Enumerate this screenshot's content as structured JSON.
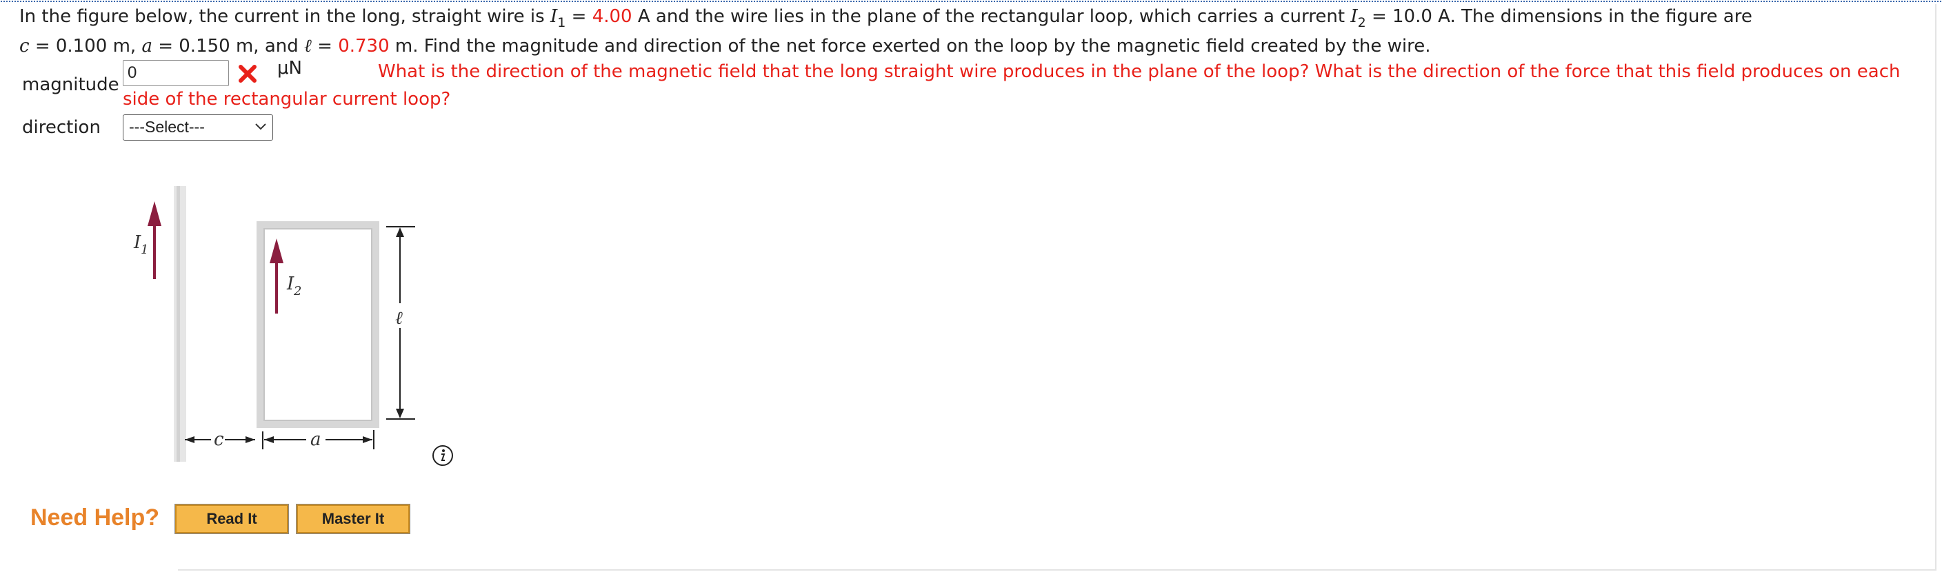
{
  "question": {
    "intro": "In the figure below, the current in the long, straight wire is ",
    "i1_symbol": "I",
    "i1_sub": "1",
    "eq1": " = ",
    "i1_value": "4.00",
    "text2": " A and the wire lies in the plane of the rectangular loop, which carries a current ",
    "i2_symbol": "I",
    "i2_sub": "2",
    "text3": " = 10.0 A. The dimensions in the figure are",
    "c_symbol": "c",
    "text4": " = 0.100 m, ",
    "a_symbol": "a",
    "text5": " = 0.150 m, and ",
    "l_symbol": "ℓ",
    "eq2": " = ",
    "l_value": "0.730",
    "text6": " m. Find the magnitude and direction of the net force exerted on the loop by the magnetic field created by the wire."
  },
  "answer": {
    "magnitude_label": "magnitude",
    "magnitude_value": "0",
    "unit": "μN",
    "feedback": "What is the direction of the magnetic field that the long straight wire produces in the plane of the loop? What is the direction of the force that this field produces on each side of the rectangular current loop?",
    "direction_label": "direction",
    "direction_selected": "---Select---"
  },
  "figure": {
    "i1_label": "I",
    "i1_sub": "1",
    "i2_label": "I",
    "i2_sub": "2",
    "l_label": "ℓ",
    "c_label": "c",
    "a_label": "a"
  },
  "help": {
    "label": "Need Help?",
    "read_it": "Read It",
    "master_it": "Master It"
  },
  "colors": {
    "accent_red": "#e8211a",
    "help_orange": "#e8832a",
    "button_fill": "#f5b84a",
    "arrow_maroon": "#8b1e3f"
  },
  "icons": [
    "incorrect-x-icon",
    "chevron-down-icon",
    "info-icon"
  ]
}
